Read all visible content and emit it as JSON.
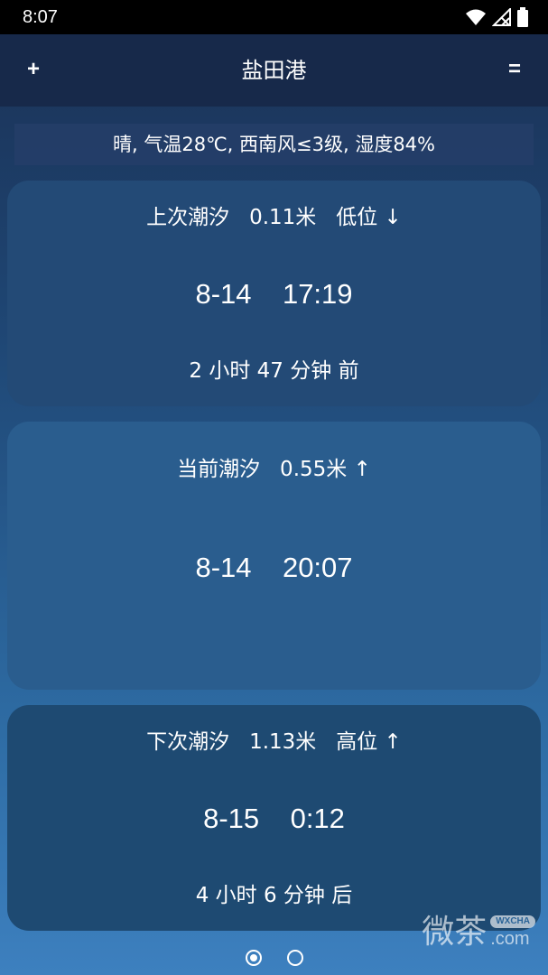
{
  "status_bar": {
    "time": "8:07",
    "icons": [
      "wifi-icon",
      "signal-off-icon",
      "battery-icon"
    ]
  },
  "app_bar": {
    "add_label": "+",
    "title": "盐田港",
    "menu_label": "="
  },
  "weather": {
    "text": "晴, 气温28℃, 西南风≤3级, 湿度84%"
  },
  "cards": {
    "previous": {
      "heading": "上次潮汐   0.11米   低位 ↓",
      "time": "8-14    17:19",
      "relative": "2 小时 47 分钟 前"
    },
    "current": {
      "heading": "当前潮汐   0.55米 ↑",
      "time": "8-14    20:07"
    },
    "next": {
      "heading": "下次潮汐   1.13米   高位 ↑",
      "time": "8-15    0:12",
      "relative": "4 小时 6 分钟 后"
    }
  },
  "pager": {
    "pages": 2,
    "active_index": 0
  },
  "watermark": {
    "main": "微茶",
    "badge": "WXCHA",
    "domain": ".com"
  },
  "colors": {
    "status_bar": "#000000",
    "app_bar": "#17294a",
    "background_top": "#1a3054",
    "background_bottom": "#3d80bf",
    "text": "#ffffff"
  }
}
